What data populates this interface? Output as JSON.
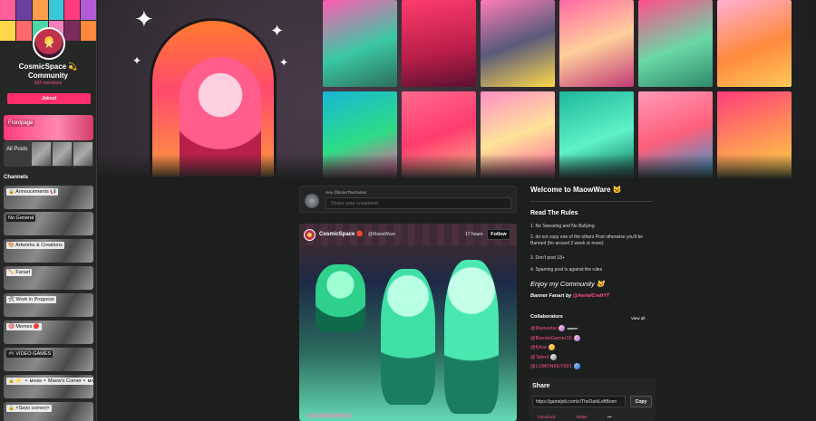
{
  "sidebar": {
    "community_name": "CosmicSpace 💫 Community",
    "members": "932 members",
    "joined_label": "Joined",
    "frontpage_label": "Frontpage",
    "all_posts_label": "All Posts",
    "channels_heading": "Channels",
    "channels": [
      {
        "label": "🔒 Annoucements 📢"
      },
      {
        "label": "No General"
      },
      {
        "label": "🎨 Artworks & Creations"
      },
      {
        "label": "✏️ Fanart"
      },
      {
        "label": "🛠 Work in Progress"
      },
      {
        "label": "🎯 Memes 🔴"
      },
      {
        "label": "🎮 VIDEO-GAMES"
      },
      {
        "label": "🔒 ⭐ ▪️ᴍᴀᴏᴡ▪️Maow's Corner▪️ᴍᴀᴏᴡ▪️"
      },
      {
        "label": "🔒 ×Sayo corner|×"
      }
    ]
  },
  "composer": {
    "hey_text": "Hey @boneTheGamer",
    "placeholder": "Share your creations!"
  },
  "post": {
    "author": "CosmicSpace 🔴",
    "handle": "@MaowWare",
    "time": "17 hours",
    "follow_label": "Follow",
    "watermark": "@COSMICSPACE"
  },
  "about": {
    "welcome": "Welcome to MaowWare 🐱",
    "rules_heading": "Read The Rules",
    "rules": [
      "1. No Swearing and No Bullying",
      "2. do not copy one of the others Post otherwise you'll be Banned (for around 2 week or more)",
      "3. Don't post 18+",
      "4. Spaming post is against the rules"
    ],
    "enjoy": "Enjoy my Community 🐱",
    "fanart_prefix": "Banner Fanart by ",
    "fanart_link": "@AerielCraftYT"
  },
  "collaborators": {
    "heading": "Collaborators",
    "view_all": "View all",
    "list": [
      {
        "name": "@Maowstar",
        "badge": "owner"
      },
      {
        "name": "@BonnieGamer16",
        "badge": ""
      },
      {
        "name": "@fykuz",
        "badge": ""
      },
      {
        "name": "@Tafect",
        "badge": ""
      },
      {
        "name": "@LUMONKEY001",
        "badge": ""
      }
    ]
  },
  "share": {
    "heading": "Share",
    "url": "https://gamejolt.com/c/TheDarkLeftBonn",
    "copy_label": "Copy",
    "facebook_label": "Facebook",
    "twitter_label": "Twitter",
    "more_label": "•••"
  },
  "colors": {
    "accent": "#ff2f6e",
    "link": "#ff4f8a",
    "background": "#1d1f1e"
  }
}
